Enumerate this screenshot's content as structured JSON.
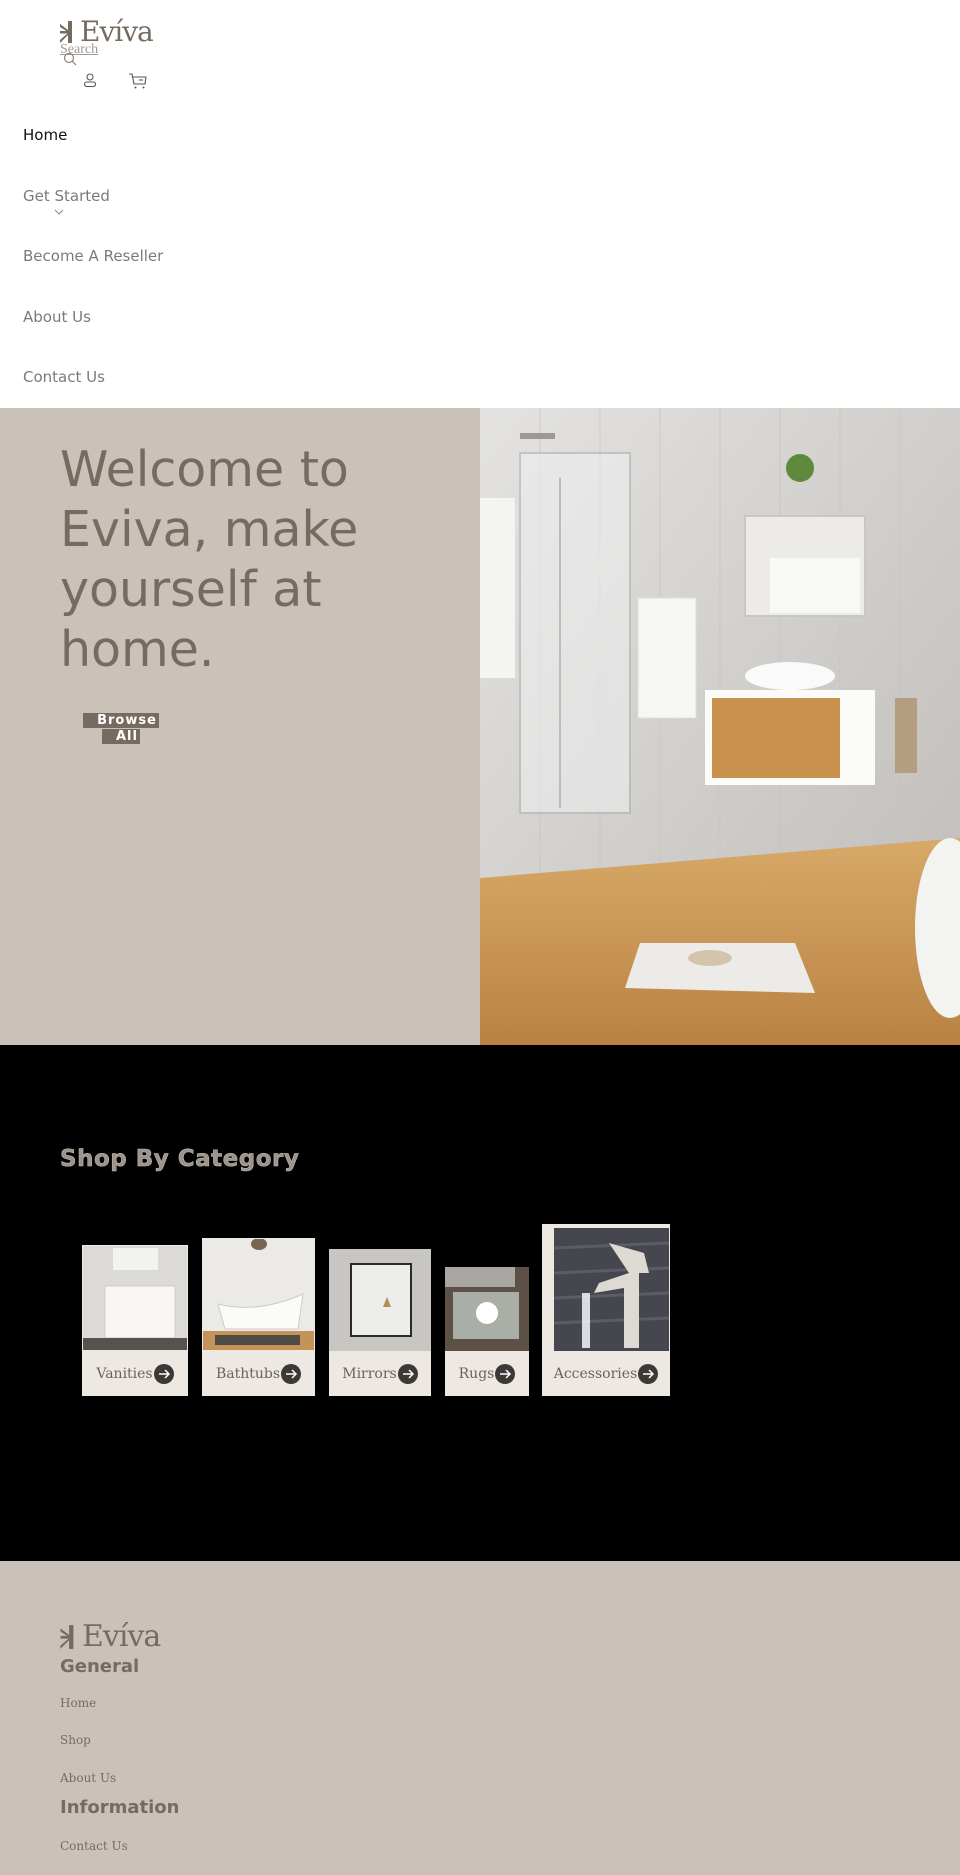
{
  "brand": {
    "name": "Evíva"
  },
  "header": {
    "search_label": "Search",
    "icons": [
      "search-icon",
      "account-icon",
      "cart-icon"
    ]
  },
  "nav": {
    "items": [
      {
        "label": "Home",
        "active": true
      },
      {
        "label": "Get Started",
        "has_dropdown": true
      },
      {
        "label": "Become A Reseller"
      },
      {
        "label": "About Us"
      },
      {
        "label": "Contact Us"
      }
    ]
  },
  "hero": {
    "title": "Welcome to Eviva, make yourself at home.",
    "button_label": "Browse All",
    "image_alt": "bathroom-scene"
  },
  "categories": {
    "title": "Shop By Category",
    "items": [
      {
        "label": "Vanities"
      },
      {
        "label": "Bathtubs"
      },
      {
        "label": "Mirrors"
      },
      {
        "label": "Rugs"
      },
      {
        "label": "Accessories"
      }
    ]
  },
  "footer": {
    "general_heading": "General",
    "general_links": [
      "Home",
      "Shop",
      "About Us"
    ],
    "information_heading": "Information",
    "information_links": [
      "Contact Us"
    ]
  },
  "colors": {
    "brand": "#766b61",
    "hero_bg": "#cac2b8",
    "category_bg": "#000000",
    "card_bg": "#ede8e2"
  }
}
